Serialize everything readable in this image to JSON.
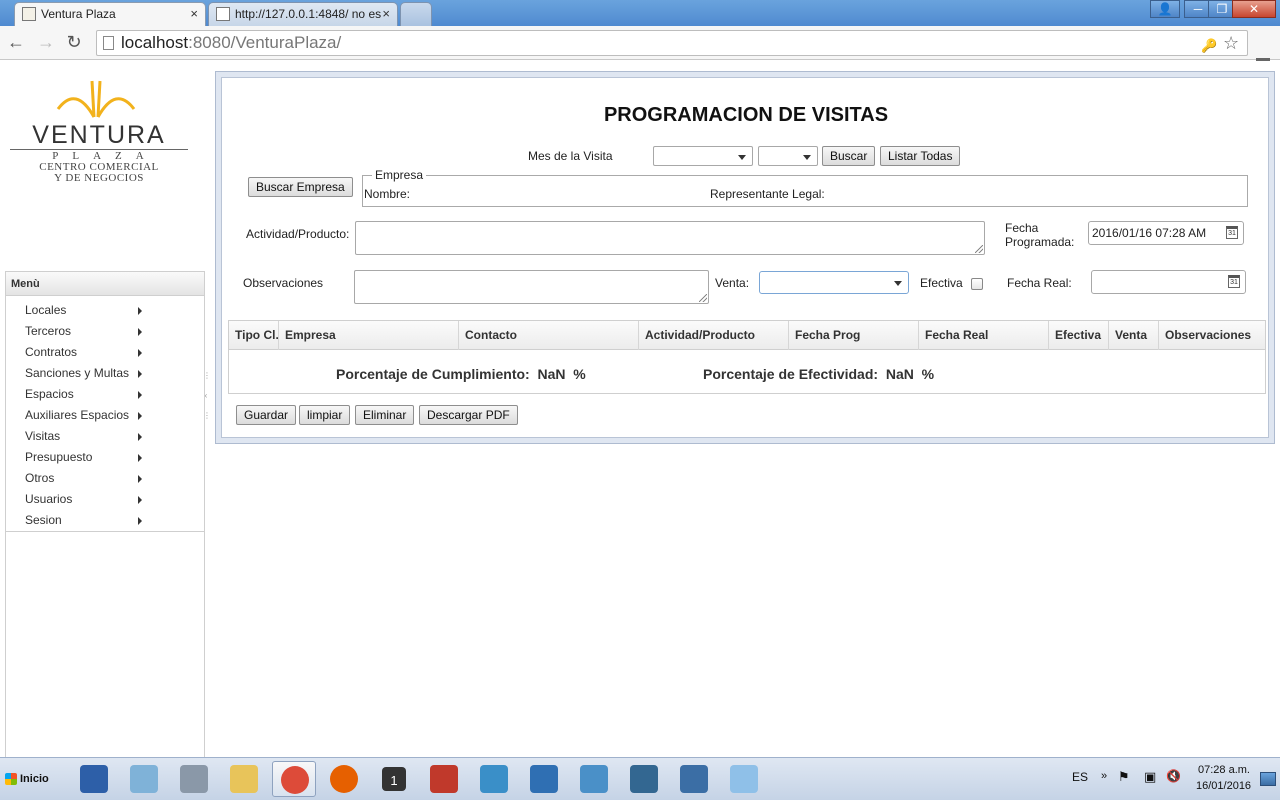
{
  "browser": {
    "tabs": [
      {
        "title": "Ventura Plaza",
        "active": true
      },
      {
        "title": "http://127.0.0.1:4848/ no es",
        "active": false
      }
    ],
    "close_glyph": "×",
    "url_host": "localhost",
    "url_rest": ":8080/VenturaPlaza/",
    "nav": {
      "back": "←",
      "forward": "→",
      "reload": "↻"
    },
    "window_controls": {
      "user": "👤",
      "minimize": "─",
      "maximize": "❐",
      "close": "✕"
    },
    "omnibox_icons": {
      "key": "🔑",
      "star": "☆"
    }
  },
  "logo": {
    "brand": "VENTURA",
    "sub1": "PLAZA",
    "sub2_line1": "CENTRO COMERCIAL",
    "sub2_line2": "Y DE NEGOCIOS",
    "colors": {
      "mark": "#f2b21c",
      "text": "#333333"
    }
  },
  "menu": {
    "header": "Menù",
    "items": [
      "Locales",
      "Terceros",
      "Contratos",
      "Sanciones y Multas",
      "Espacios",
      "Auxiliares Espacios",
      "Visitas",
      "Presupuesto",
      "Otros",
      "Usuarios",
      "Sesion"
    ]
  },
  "form": {
    "title": "PROGRAMACION DE VISITAS",
    "mes_label": "Mes de la Visita",
    "mes_value": "",
    "anio_value": "",
    "buscar": "Buscar",
    "listar_todas": "Listar Todas",
    "buscar_empresa": "Buscar Empresa",
    "empresa_legend": "Empresa",
    "nombre_label": "Nombre:",
    "representante_label": "Representante Legal:",
    "actividad_label": "Actividad/Producto:",
    "actividad_value": "",
    "fecha_prog_label_1": "Fecha",
    "fecha_prog_label_2": "Programada:",
    "fecha_prog_value": "2016/01/16 07:28 AM",
    "observaciones_label": "Observaciones",
    "observaciones_value": "",
    "venta_label": "Venta:",
    "venta_value": "",
    "efectiva_label": "Efectiva",
    "efectiva_checked": false,
    "fecha_real_label": "Fecha Real:",
    "fecha_real_value": "",
    "calendar_icon_text": "31"
  },
  "table": {
    "columns": [
      "Tipo Cl.",
      "Empresa",
      "Contacto",
      "Actividad/Producto",
      "Fecha Prog",
      "Fecha Real",
      "Efectiva",
      "Venta",
      "Observaciones"
    ],
    "rows": [],
    "cumplimiento_label": "Porcentaje de Cumplimiento:",
    "cumplimiento_value": "NaN",
    "efectividad_label": "Porcentaje de Efectividad:",
    "efectividad_value": "NaN",
    "percent_sign": "%"
  },
  "actions": {
    "guardar": "Guardar",
    "limpiar": "limpiar",
    "eliminar": "Eliminar",
    "descargar": "Descargar PDF"
  },
  "taskbar": {
    "start": "Inicio",
    "apps": [
      {
        "name": "powershell-icon",
        "color": "#2d5fa8"
      },
      {
        "name": "server-manager-icon",
        "color": "#7fb2d8"
      },
      {
        "name": "network-icon",
        "color": "#8a98a8"
      },
      {
        "name": "folder-icon",
        "color": "#e8c45a"
      },
      {
        "name": "chrome-icon",
        "color": "#dd4b39",
        "active": true
      },
      {
        "name": "firefox-icon",
        "color": "#e66000"
      },
      {
        "name": "console-icon",
        "color": "#333333",
        "label": "1"
      },
      {
        "name": "java-icon",
        "color": "#c0392b"
      },
      {
        "name": "editor-icon",
        "color": "#3a8fc8"
      },
      {
        "name": "users-icon",
        "color": "#2f6fb3"
      },
      {
        "name": "control-panel-icon",
        "color": "#4a90c8"
      },
      {
        "name": "postgres-icon",
        "color": "#336791"
      },
      {
        "name": "remote-desktop-icon",
        "color": "#3b6ea5"
      },
      {
        "name": "notepad-icon",
        "color": "#8fc0e8"
      }
    ],
    "language": "ES",
    "tray_icons": {
      "chevron": "»",
      "flag": "⚑",
      "network": "▣",
      "volume": "🔇"
    },
    "time": "07:28 a.m.",
    "date": "16/01/2016"
  }
}
